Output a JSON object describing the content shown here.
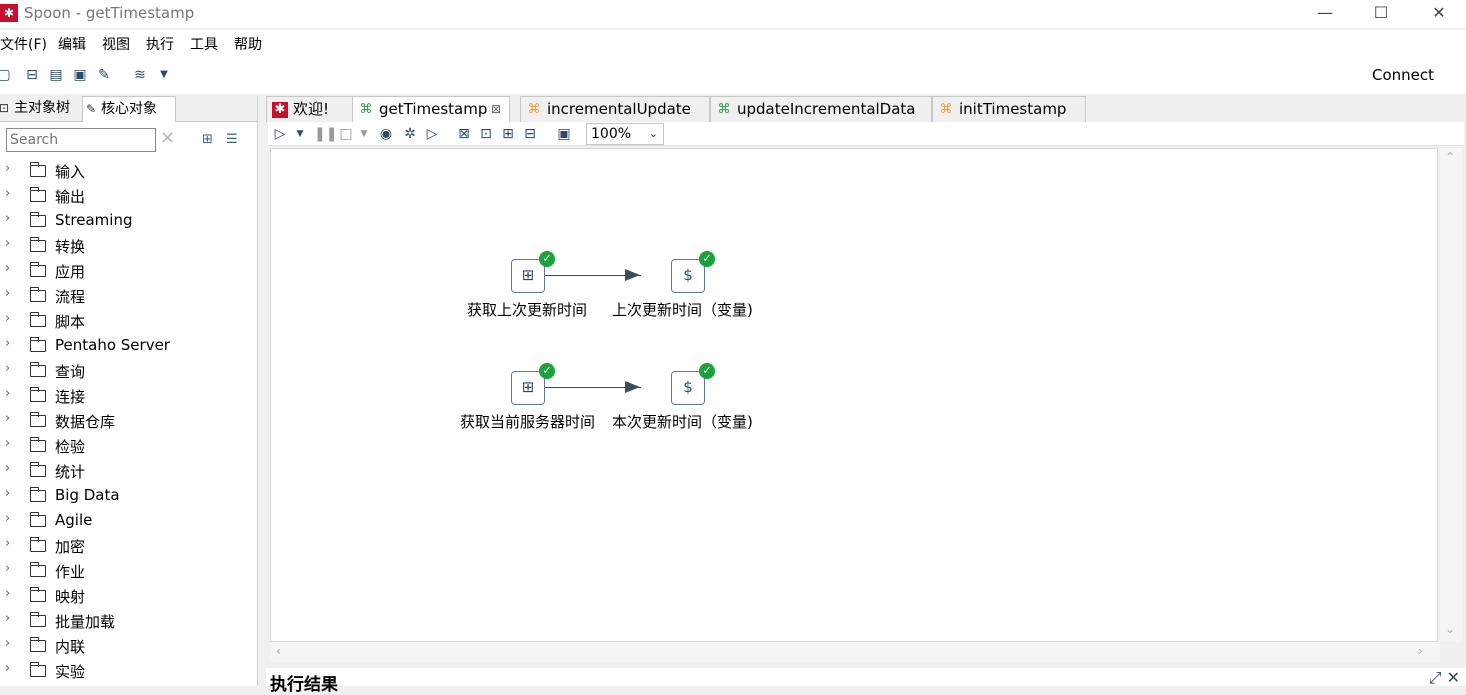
{
  "window": {
    "title": "Spoon - getTimestamp",
    "icon": "spoon-logo"
  },
  "menubar": {
    "items": [
      "文件(F)",
      "编辑",
      "视图",
      "执行",
      "工具",
      "帮助"
    ]
  },
  "toolbar": {
    "connect_label": "Connect"
  },
  "left_panel": {
    "tabs": [
      "主对象树",
      "核心对象"
    ],
    "search_placeholder": "Search",
    "tree": [
      "输入",
      "输出",
      "Streaming",
      "转换",
      "应用",
      "流程",
      "脚本",
      "Pentaho Server",
      "查询",
      "连接",
      "数据仓库",
      "检验",
      "统计",
      "Big Data",
      "Agile",
      "加密",
      "作业",
      "映射",
      "批量加载",
      "内联",
      "实验"
    ]
  },
  "editor_tabs": [
    {
      "label": "欢迎!",
      "icon": "spoon-icon"
    },
    {
      "label": "getTimestamp",
      "icon": "transformation-icon",
      "active": true
    },
    {
      "label": "incrementalUpdate",
      "icon": "job-icon"
    },
    {
      "label": "updateIncrementalData",
      "icon": "transformation-icon"
    },
    {
      "label": "initTimestamp",
      "icon": "job-icon"
    }
  ],
  "canvas_toolbar": {
    "zoom": "100%"
  },
  "steps": [
    {
      "label": "获取上次更新时间",
      "type": "table-input",
      "status": "ok"
    },
    {
      "label": "上次更新时间（变量)",
      "type": "set-variables",
      "status": "ok"
    },
    {
      "label": "获取当前服务器时间",
      "type": "table-input",
      "status": "ok"
    },
    {
      "label": "本次更新时间（变量)",
      "type": "set-variables",
      "status": "ok"
    }
  ],
  "results": {
    "title": "执行结果"
  },
  "colors": {
    "accent": "#2c4a6a",
    "ok": "#1aa33a",
    "spoon_red": "#c8102e",
    "job_orange": "#f0a030",
    "trans_green": "#2e9a4a"
  }
}
